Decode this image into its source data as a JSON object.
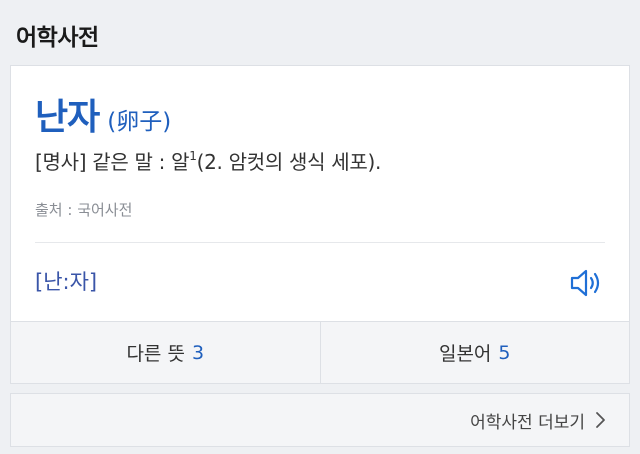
{
  "section": {
    "title": "어학사전"
  },
  "entry": {
    "headword": "난자",
    "hanja": "(卵子)",
    "definition_prefix": "[명사] 같은 말 : 알",
    "definition_sup": "1",
    "definition_suffix": "(2. 암컷의 생식 세포).",
    "source": "출처 : 국어사전",
    "pronunciation": "[난:자]",
    "speaker_icon": "speaker-icon"
  },
  "tabs": [
    {
      "label": "다른 뜻",
      "count": "3"
    },
    {
      "label": "일본어",
      "count": "5"
    }
  ],
  "more": {
    "label": "어학사전 더보기",
    "icon": "chevron-right-icon"
  },
  "colors": {
    "accent": "#1f5fbd",
    "pronunciation": "#3a55a8",
    "background": "#eef0f3"
  }
}
